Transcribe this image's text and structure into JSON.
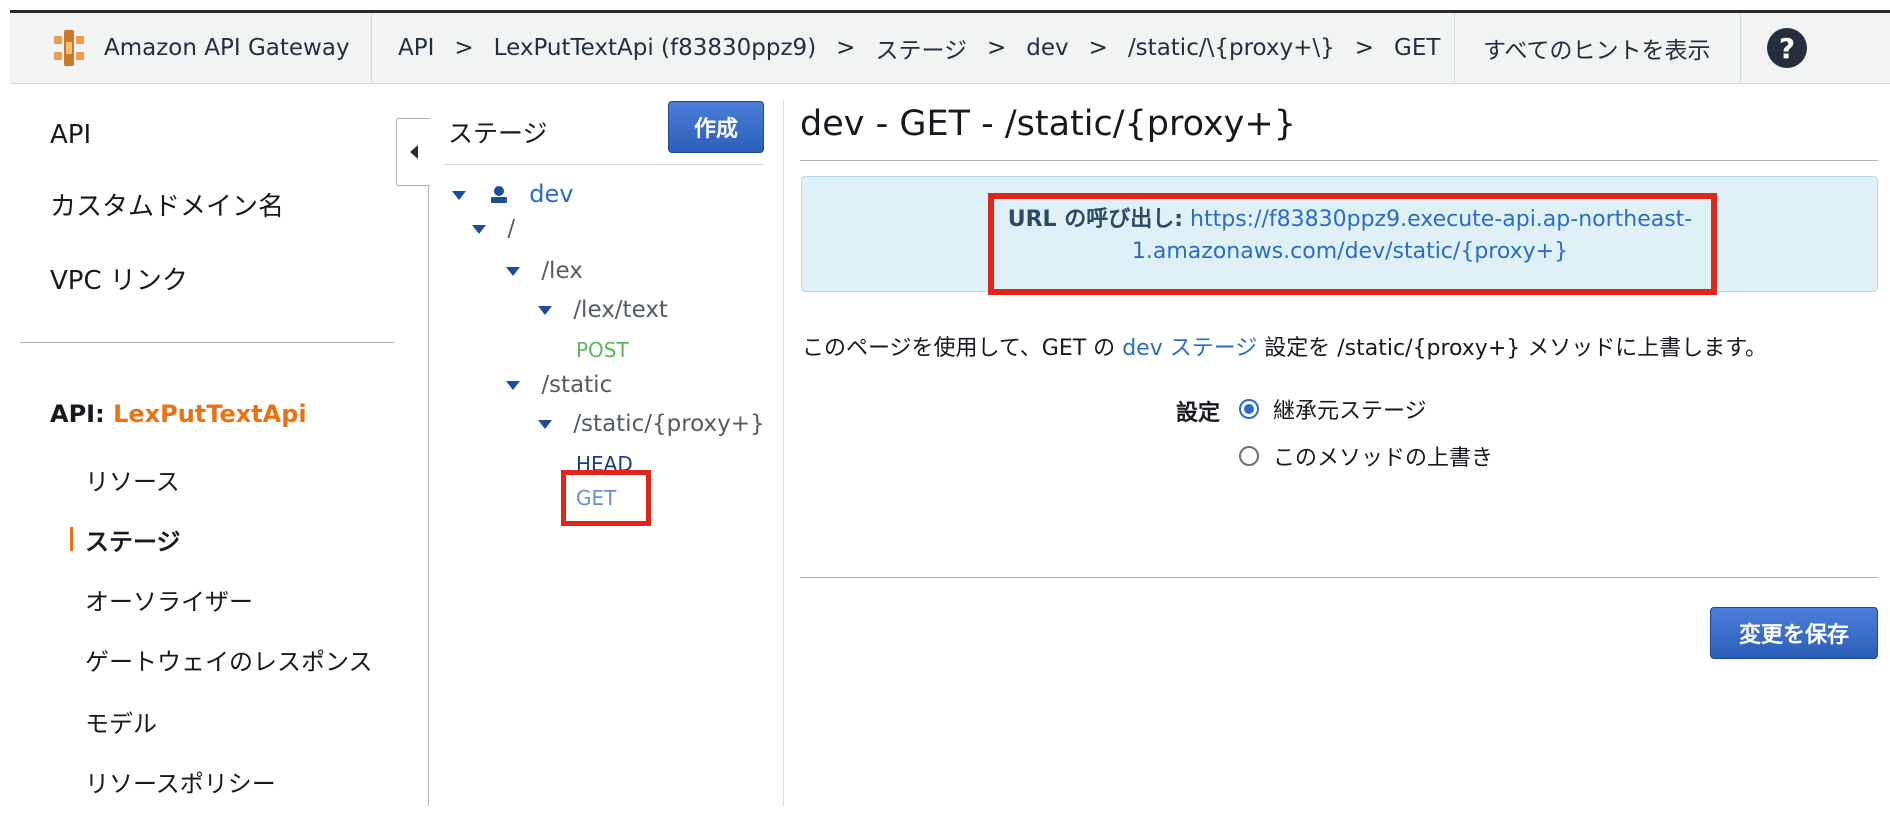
{
  "header": {
    "brand": "Amazon API Gateway",
    "breadcrumbs": [
      "API",
      "LexPutTextApi (f83830ppz9)",
      "ステージ",
      "dev",
      "/static/\\{proxy+\\}",
      "GET"
    ],
    "breadcrumb_separator": ">",
    "show_hints": "すべてのヒントを表示",
    "help_icon": "?"
  },
  "leftnav": {
    "top_items": [
      "API",
      "カスタムドメイン名",
      "VPC リンク"
    ],
    "api_prefix": "API:",
    "api_name": "LexPutTextApi",
    "sub_items": [
      "リソース",
      "ステージ",
      "オーソライザー",
      "ゲートウェイのレスポンス",
      "モデル",
      "リソースポリシー"
    ],
    "active_item": "ステージ"
  },
  "stages_panel": {
    "title": "ステージ",
    "create_button": "作成",
    "tree": {
      "stage": "dev",
      "root": "/",
      "lex": "/lex",
      "lex_text": "/lex/text",
      "post": "POST",
      "static": "/static",
      "static_proxy": "/static/{proxy+}",
      "head": "HEAD",
      "get": "GET"
    }
  },
  "main": {
    "title": "dev - GET - /static/{proxy+}",
    "invoke_label": "URL の呼び出し:",
    "invoke_url_line1": "https://f83830ppz9.execute-api.ap-northeast-",
    "invoke_url_line2": "1.amazonaws.com/dev/static/{proxy+}",
    "desc_before": "このページを使用して、GET の ",
    "desc_link": "dev ステージ",
    "desc_after": " 設定を /static/{proxy+} メソッドに上書します。",
    "settings_label": "設定",
    "option_inherit": "継承元ステージ",
    "option_override": "このメソッドの上書き",
    "selected_option": "継承元ステージ",
    "save_button": "変更を保存"
  },
  "colors": {
    "accent_orange": "#ec7211",
    "link_blue": "#2a6cc7",
    "highlight_red": "#e0261b",
    "info_bg": "#dff0f6",
    "button_blue": "#2d5fb9"
  }
}
